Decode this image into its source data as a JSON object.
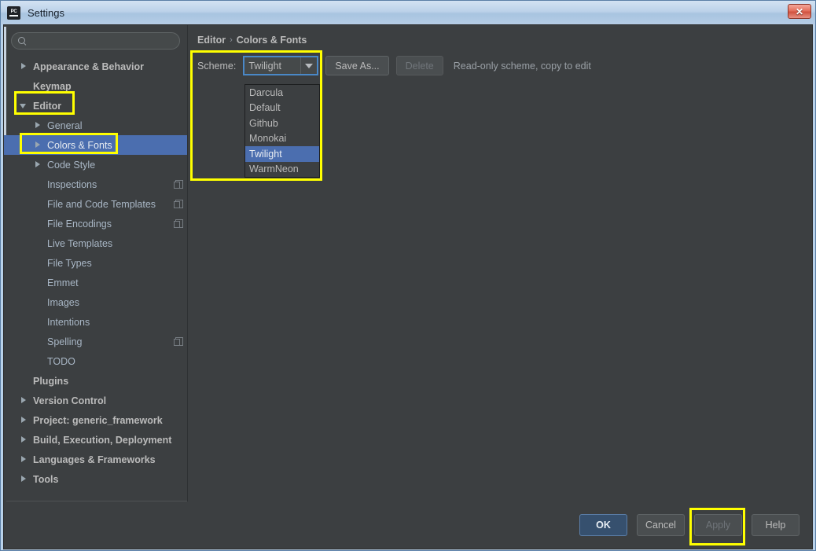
{
  "window": {
    "title": "Settings",
    "app_icon": "pycharm-icon",
    "close_label": "✕"
  },
  "sidebar": {
    "search": {
      "value": "",
      "placeholder": "",
      "icon": "search-icon"
    },
    "items": [
      {
        "label": "Appearance & Behavior",
        "arrow": "right",
        "indent": 0,
        "bold": true,
        "copy": false,
        "selected": false
      },
      {
        "label": "Keymap",
        "arrow": "none",
        "indent": 0,
        "bold": true,
        "copy": false,
        "selected": false
      },
      {
        "label": "Editor",
        "arrow": "down",
        "indent": 0,
        "bold": true,
        "copy": false,
        "selected": false
      },
      {
        "label": "General",
        "arrow": "right",
        "indent": 1,
        "bold": false,
        "copy": false,
        "selected": false
      },
      {
        "label": "Colors & Fonts",
        "arrow": "right",
        "indent": 1,
        "bold": false,
        "copy": false,
        "selected": true
      },
      {
        "label": "Code Style",
        "arrow": "right",
        "indent": 1,
        "bold": false,
        "copy": false,
        "selected": false
      },
      {
        "label": "Inspections",
        "arrow": "none",
        "indent": 1,
        "bold": false,
        "copy": true,
        "selected": false
      },
      {
        "label": "File and Code Templates",
        "arrow": "none",
        "indent": 1,
        "bold": false,
        "copy": true,
        "selected": false
      },
      {
        "label": "File Encodings",
        "arrow": "none",
        "indent": 1,
        "bold": false,
        "copy": true,
        "selected": false
      },
      {
        "label": "Live Templates",
        "arrow": "none",
        "indent": 1,
        "bold": false,
        "copy": false,
        "selected": false
      },
      {
        "label": "File Types",
        "arrow": "none",
        "indent": 1,
        "bold": false,
        "copy": false,
        "selected": false
      },
      {
        "label": "Emmet",
        "arrow": "none",
        "indent": 1,
        "bold": false,
        "copy": false,
        "selected": false
      },
      {
        "label": "Images",
        "arrow": "none",
        "indent": 1,
        "bold": false,
        "copy": false,
        "selected": false
      },
      {
        "label": "Intentions",
        "arrow": "none",
        "indent": 1,
        "bold": false,
        "copy": false,
        "selected": false
      },
      {
        "label": "Spelling",
        "arrow": "none",
        "indent": 1,
        "bold": false,
        "copy": true,
        "selected": false
      },
      {
        "label": "TODO",
        "arrow": "none",
        "indent": 1,
        "bold": false,
        "copy": false,
        "selected": false
      },
      {
        "label": "Plugins",
        "arrow": "none",
        "indent": 0,
        "bold": true,
        "copy": false,
        "selected": false
      },
      {
        "label": "Version Control",
        "arrow": "right",
        "indent": 0,
        "bold": true,
        "copy": false,
        "selected": false
      },
      {
        "label": "Project: generic_framework",
        "arrow": "right",
        "indent": 0,
        "bold": true,
        "copy": false,
        "selected": false
      },
      {
        "label": "Build, Execution, Deployment",
        "arrow": "right",
        "indent": 0,
        "bold": true,
        "copy": false,
        "selected": false
      },
      {
        "label": "Languages & Frameworks",
        "arrow": "right",
        "indent": 0,
        "bold": true,
        "copy": false,
        "selected": false
      },
      {
        "label": "Tools",
        "arrow": "right",
        "indent": 0,
        "bold": true,
        "copy": false,
        "selected": false
      }
    ]
  },
  "main": {
    "breadcrumb": {
      "parent": "Editor",
      "separator": "›",
      "current": "Colors & Fonts"
    },
    "scheme": {
      "label": "Scheme:",
      "value": "Twilight",
      "dropdown_open": true,
      "options": [
        "Darcula",
        "Default",
        "Github",
        "Monokai",
        "Twilight",
        "WarmNeon"
      ],
      "selected_option": "Twilight"
    },
    "save_as_label": "Save As...",
    "delete_label": "Delete",
    "readonly_note": "Read-only scheme, copy to edit"
  },
  "buttons": {
    "ok": "OK",
    "cancel": "Cancel",
    "apply": "Apply",
    "help": "Help"
  },
  "colors": {
    "accent_selection": "#4b6eaf",
    "annotation": "#ffff00",
    "panel_bg": "#3c3f41",
    "focus_border": "#4a88c7",
    "primary_button": "#36506e"
  }
}
